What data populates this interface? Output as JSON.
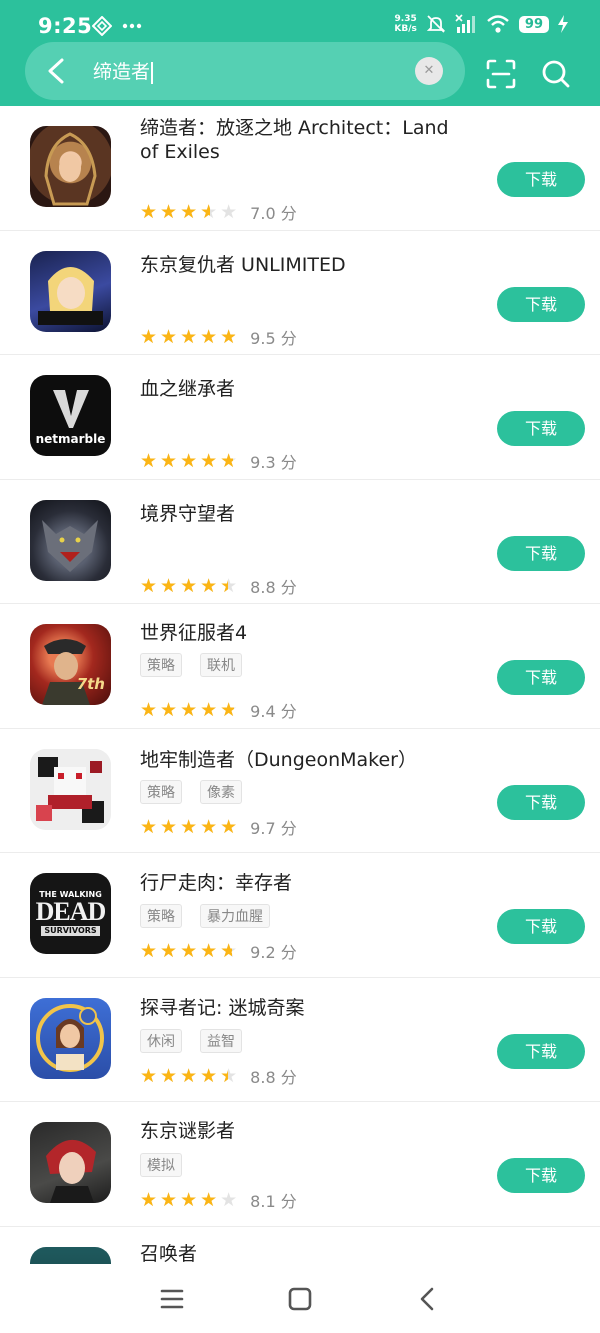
{
  "status_bar": {
    "time": "9:25",
    "net_speed_value": "9.35",
    "net_speed_unit": "KB/s",
    "battery": "99"
  },
  "search": {
    "query": "缔造者"
  },
  "colors": {
    "accent": "#2cc19c",
    "star": "#fbb515"
  },
  "results": [
    {
      "title": "缔造者：放逐之地 Architect：Land of Exiles",
      "tags": [],
      "rating": 0.7,
      "score": "7.0 分",
      "download_label": "下载",
      "icon": "hooded-hero-icon"
    },
    {
      "title": "东京复仇者 UNLIMITED",
      "tags": [],
      "rating": 0.95,
      "score": "9.5 分",
      "download_label": "下载",
      "icon": "anime-character-icon"
    },
    {
      "title": "血之继承者",
      "tags": [],
      "rating": 0.93,
      "score": "9.3 分",
      "download_label": "下载",
      "icon": "netmarble-v-icon"
    },
    {
      "title": "境界守望者",
      "tags": [],
      "rating": 0.88,
      "score": "8.8 分",
      "download_label": "下载",
      "icon": "werewolf-icon"
    },
    {
      "title": "世界征服者4",
      "tags": [
        "策略",
        "联机"
      ],
      "rating": 0.94,
      "score": "9.4 分",
      "download_label": "下载",
      "icon": "general-7th-anniv-icon"
    },
    {
      "title": "地牢制造者（DungeonMaker）",
      "tags": [
        "策略",
        "像素"
      ],
      "rating": 0.97,
      "score": "9.7 分",
      "download_label": "下载",
      "icon": "pixel-character-icon"
    },
    {
      "title": "行尸走肉：幸存者",
      "tags": [
        "策略",
        "暴力血腥"
      ],
      "rating": 0.92,
      "score": "9.2 分",
      "download_label": "下载",
      "icon": "walking-dead-icon"
    },
    {
      "title": "探寻者记: 迷城奇案",
      "tags": [
        "休闲",
        "益智"
      ],
      "rating": 0.88,
      "score": "8.8 分",
      "download_label": "下载",
      "icon": "detective-woman-icon"
    },
    {
      "title": "东京谜影者",
      "tags": [
        "模拟"
      ],
      "rating": 0.81,
      "score": "8.1 分",
      "download_label": "下载",
      "icon": "red-hair-character-icon"
    },
    {
      "title": "召唤者",
      "tags": [],
      "rating": null,
      "score": "",
      "download_label": "",
      "icon": "summoner-icon"
    }
  ],
  "icon_texts": {
    "netmarble": "netmarble",
    "walking_dead_top": "THE WALKING",
    "walking_dead_main": "DEAD",
    "walking_dead_sub": "SURVIVORS",
    "anniv": "7th"
  }
}
